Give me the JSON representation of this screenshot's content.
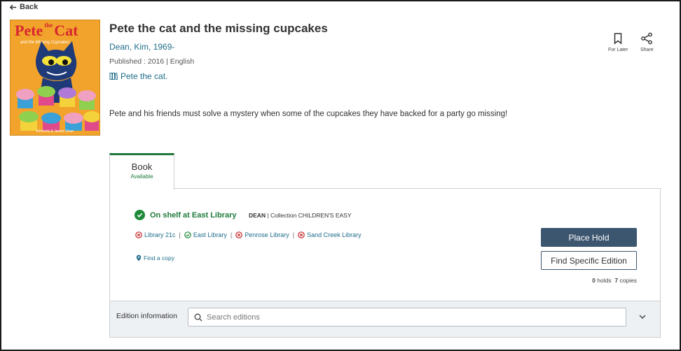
{
  "nav": {
    "back_label": "Back"
  },
  "cover": {
    "title_pete": "Pete",
    "title_the": "the",
    "title_cat": "Cat",
    "subtitle": "and the Missing Cupcakes",
    "authors": "Kimberly & James Dean"
  },
  "book": {
    "title": "Pete the cat and the missing cupcakes",
    "author": "Dean, Kim, 1969-",
    "published": "Published : 2016 | English",
    "series": "Pete the cat.",
    "summary": "Pete and his friends must solve a mystery when some of the cupcakes they have backed for a party go missing!"
  },
  "actions": {
    "for_later": "For Later",
    "share": "Share"
  },
  "tab": {
    "label": "Book",
    "status": "Available"
  },
  "availability": {
    "status": "On shelf at East Library",
    "call_number": "DEAN",
    "collection": " | Collection CHILDREN'S EASY",
    "libraries": [
      {
        "name": "Library 21c",
        "available": false
      },
      {
        "name": "East Library",
        "available": true
      },
      {
        "name": "Penrose Library",
        "available": false
      },
      {
        "name": "Sand Creek Library",
        "available": false
      }
    ],
    "find_copy": "Find a copy"
  },
  "buttons": {
    "place_hold": "Place Hold",
    "find_edition": "Find Specific Edition"
  },
  "counts": {
    "holds": "0",
    "holds_label": " holds",
    "copies": "7",
    "copies_label": " copies"
  },
  "edition": {
    "label": "Edition information",
    "search_placeholder": "Search editions"
  },
  "colors": {
    "accent_green": "#1d7a3a",
    "link_blue": "#1f6d8a",
    "unavailable_red": "#c62828",
    "button_navy": "#3d5670"
  }
}
